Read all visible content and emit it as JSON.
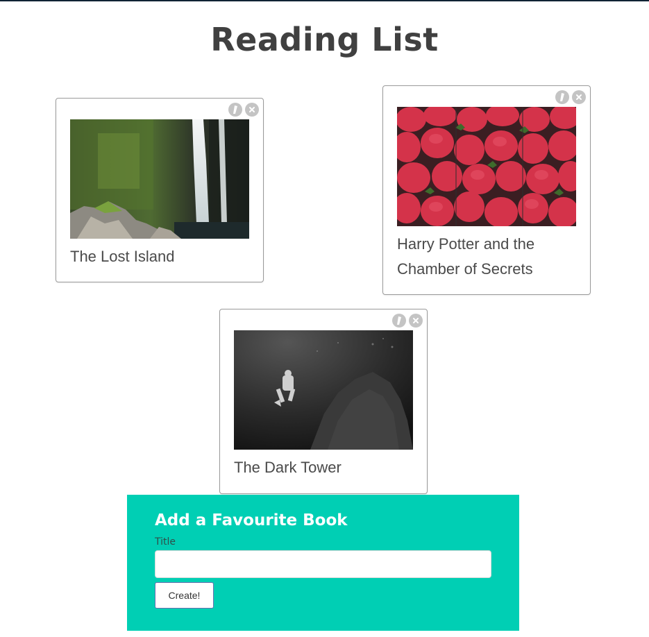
{
  "page": {
    "title": "Reading List"
  },
  "books": [
    {
      "title": "The Lost Island",
      "image": "waterfall-photo"
    },
    {
      "title": "Harry Potter and the Chamber of Secrets",
      "image": "strawberries-photo"
    },
    {
      "title": "The Dark Tower",
      "image": "diver-photo"
    }
  ],
  "card_actions": {
    "edit_icon": "pencil-icon",
    "delete_icon": "close-icon"
  },
  "form": {
    "heading": "Add a Favourite Book",
    "title_label": "Title",
    "title_value": "",
    "title_placeholder": "",
    "submit_label": "Create!"
  },
  "colors": {
    "form_background": "#00cfb4",
    "title_text": "#404040",
    "action_icon": "#c4c4c4"
  }
}
